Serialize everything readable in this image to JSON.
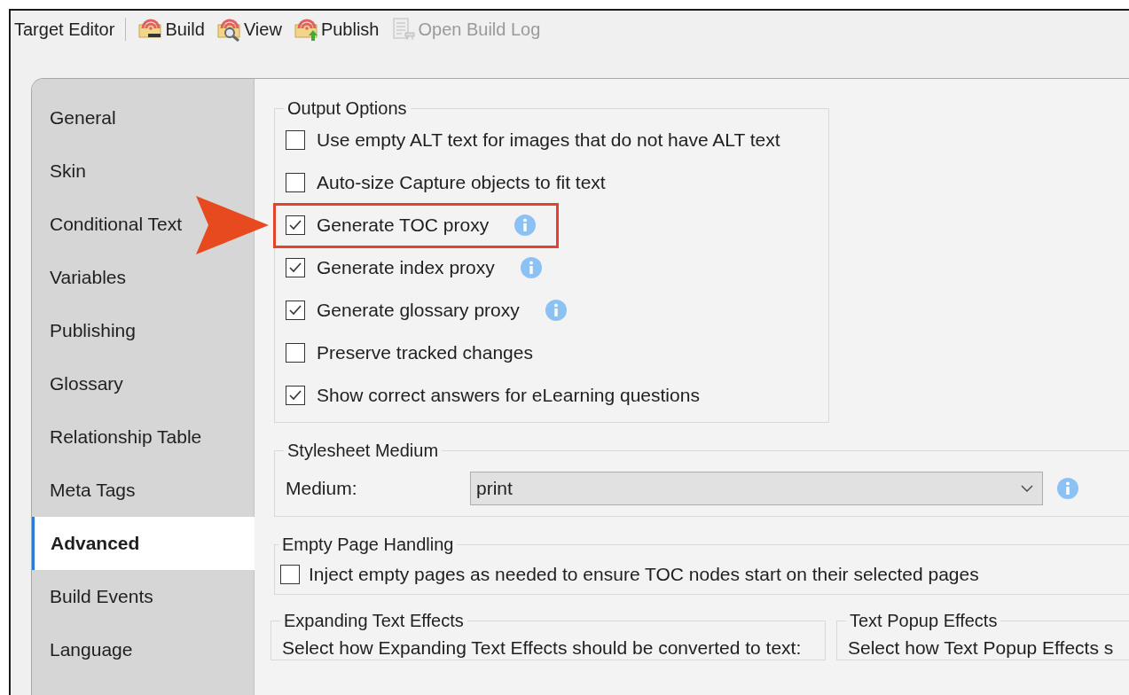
{
  "toolbar": {
    "title": "Target Editor",
    "buttons": [
      {
        "kind": "build",
        "label": "Build",
        "disabled": false
      },
      {
        "kind": "view",
        "label": "View",
        "disabled": false
      },
      {
        "kind": "publish",
        "label": "Publish",
        "disabled": false
      },
      {
        "kind": "log",
        "label": "Open Build Log",
        "disabled": true
      }
    ]
  },
  "tabs": [
    {
      "label": "General",
      "selected": false
    },
    {
      "label": "Skin",
      "selected": false
    },
    {
      "label": "Conditional Text",
      "selected": false
    },
    {
      "label": "Variables",
      "selected": false
    },
    {
      "label": "Publishing",
      "selected": false
    },
    {
      "label": "Glossary",
      "selected": false
    },
    {
      "label": "Relationship Table",
      "selected": false
    },
    {
      "label": "Meta Tags",
      "selected": false
    },
    {
      "label": "Advanced",
      "selected": true
    },
    {
      "label": "Build Events",
      "selected": false
    },
    {
      "label": "Language",
      "selected": false
    }
  ],
  "output_options": {
    "title": "Output Options",
    "options": [
      {
        "label": "Use empty ALT text for images that do not have ALT text",
        "checked": false,
        "info": false,
        "highlighted": false
      },
      {
        "label": "Auto-size Capture objects to fit text",
        "checked": false,
        "info": false,
        "highlighted": false
      },
      {
        "label": "Generate TOC proxy",
        "checked": true,
        "info": true,
        "highlighted": true
      },
      {
        "label": "Generate index proxy",
        "checked": true,
        "info": true,
        "highlighted": false
      },
      {
        "label": "Generate glossary proxy",
        "checked": true,
        "info": true,
        "highlighted": false
      },
      {
        "label": "Preserve tracked changes",
        "checked": false,
        "info": false,
        "highlighted": false
      },
      {
        "label": "Show correct answers for eLearning questions",
        "checked": true,
        "info": false,
        "highlighted": false
      }
    ]
  },
  "stylesheet_medium": {
    "title": "Stylesheet Medium",
    "label": "Medium:",
    "value": "print",
    "info": true
  },
  "empty_page_handling": {
    "title": "Empty Page Handling",
    "option": {
      "label": "Inject empty pages as needed to ensure TOC nodes start on their selected pages",
      "checked": false
    }
  },
  "expanding_text_effects": {
    "title": "Expanding Text Effects",
    "description": "Select how Expanding Text Effects should be converted to text:"
  },
  "text_popup_effects": {
    "title": "Text Popup Effects",
    "description": "Select how Text Popup Effects s"
  }
}
